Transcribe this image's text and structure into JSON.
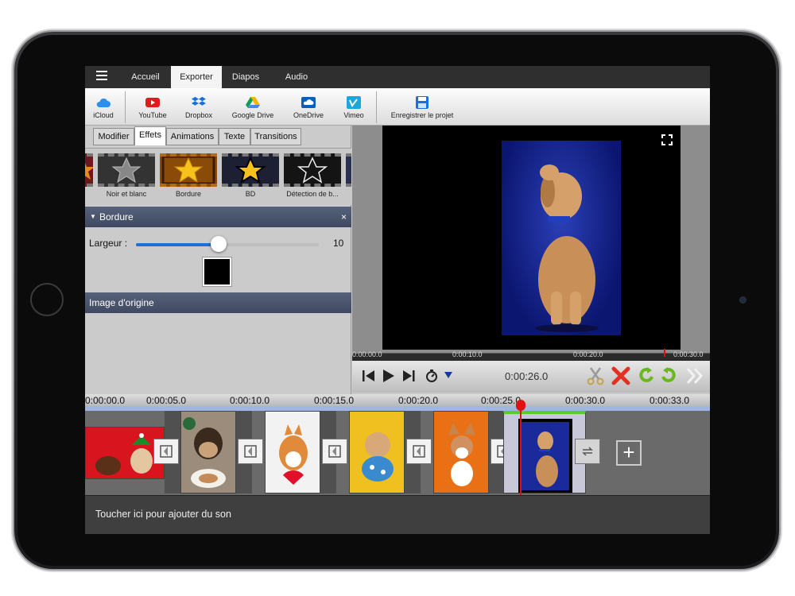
{
  "menu": {
    "tabs": [
      {
        "label": "Accueil"
      },
      {
        "label": "Exporter"
      },
      {
        "label": "Diapos"
      },
      {
        "label": "Audio"
      }
    ],
    "active_tab": "Exporter"
  },
  "toolbar": {
    "items": [
      {
        "label": "iCloud",
        "icon": "cloud-icon",
        "color": "#2a8ff0"
      },
      {
        "label": "YouTube",
        "icon": "youtube-icon",
        "color": "#e01b1b"
      },
      {
        "label": "Dropbox",
        "icon": "dropbox-icon",
        "color": "#1a6fe0"
      },
      {
        "label": "Google Drive",
        "icon": "google-drive-icon",
        "color": "#f4b400"
      },
      {
        "label": "OneDrive",
        "icon": "onedrive-icon",
        "color": "#0a5fb8"
      },
      {
        "label": "Vimeo",
        "icon": "vimeo-icon",
        "color": "#1aa8dc"
      },
      {
        "label": "Enregistrer le projet",
        "icon": "save-icon",
        "color": "#1a6fe0"
      }
    ]
  },
  "subtabs": [
    {
      "label": "Modifier"
    },
    {
      "label": "Effets"
    },
    {
      "label": "Animations"
    },
    {
      "label": "Texte"
    },
    {
      "label": "Transitions"
    }
  ],
  "active_subtab": "Effets",
  "effects": [
    {
      "label": "Noir et blanc"
    },
    {
      "label": "Bordure"
    },
    {
      "label": "BD"
    },
    {
      "label": "Détection de b..."
    }
  ],
  "border_panel": {
    "title": "Bordure",
    "close_glyph": "×",
    "width_label": "Largeur :",
    "width_value": "10",
    "width_fraction": 0.45,
    "color": "#000000"
  },
  "original_panel": {
    "title": "Image d'origine"
  },
  "preview": {
    "ticks": [
      "0:00:00.0",
      "0:00:10.0",
      "0:00:20.0",
      "0:00:30.0"
    ],
    "timecode": "0:00:26.0"
  },
  "timeline": {
    "ruler": [
      "0:00:00.0",
      "0:00:05.0",
      "0:00:10.0",
      "0:00:15.0",
      "0:00:20.0",
      "0:00:25.0",
      "0:00:30.0",
      "0:00:33.0"
    ],
    "add_label": "+"
  },
  "audio": {
    "hint": "Toucher ici pour ajouter du son"
  },
  "colors": {
    "accent": "#1f6fd6",
    "panel_header": "#4a556e",
    "playhead": "#e01010",
    "delete": "#e53020",
    "redo": "#6ab820"
  }
}
